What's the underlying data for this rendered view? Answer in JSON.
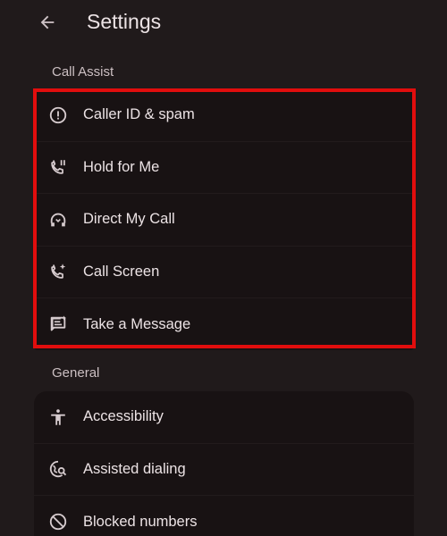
{
  "header": {
    "title": "Settings"
  },
  "sections": {
    "call_assist": {
      "label": "Call Assist",
      "items": [
        {
          "label": "Caller ID & spam",
          "icon": "alert-circle-icon"
        },
        {
          "label": "Hold for Me",
          "icon": "phone-pause-icon"
        },
        {
          "label": "Direct My Call",
          "icon": "headset-call-icon"
        },
        {
          "label": "Call Screen",
          "icon": "phone-sparkle-icon"
        },
        {
          "label": "Take a Message",
          "icon": "message-sparkle-icon"
        }
      ]
    },
    "general": {
      "label": "General",
      "items": [
        {
          "label": "Accessibility",
          "icon": "accessibility-icon"
        },
        {
          "label": "Assisted dialing",
          "icon": "globe-search-icon"
        },
        {
          "label": "Blocked numbers",
          "icon": "block-icon"
        }
      ]
    }
  },
  "colors": {
    "background": "#201a1b",
    "card": "#181213",
    "highlight": "#e10d0d",
    "text": "#ece3e5",
    "section_label": "#cbbfc2"
  }
}
